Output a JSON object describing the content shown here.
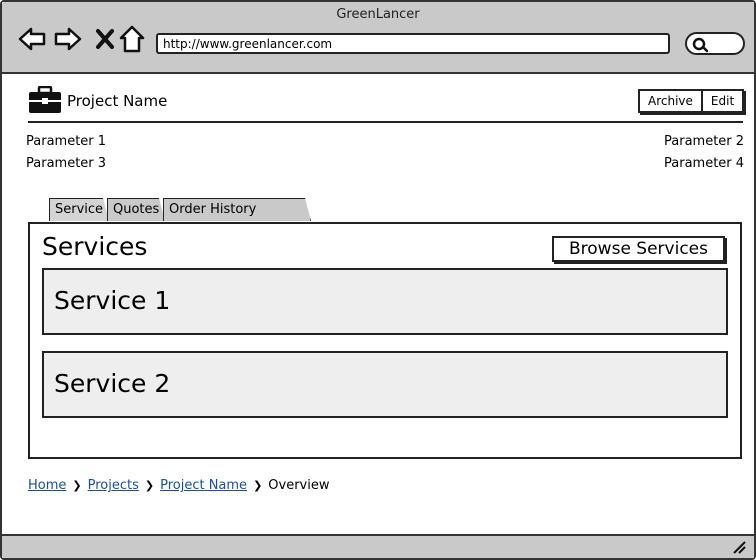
{
  "window": {
    "title": "GreenLancer"
  },
  "browser": {
    "url": "http://www.greenlancer.com",
    "back_icon": "arrow-left-icon",
    "forward_icon": "arrow-right-icon",
    "stop_icon": "close-icon",
    "home_icon": "home-icon",
    "search_icon": "search-icon"
  },
  "header": {
    "icon": "briefcase-icon",
    "project_name": "Project Name",
    "buttons": {
      "archive": "Archive",
      "edit": "Edit"
    }
  },
  "parameters": {
    "p1": "Parameter 1",
    "p2": "Parameter 2",
    "p3": "Parameter 3",
    "p4": "Parameter 4"
  },
  "tabs": [
    {
      "label": "Service",
      "active": true
    },
    {
      "label": "Quotes",
      "active": false
    },
    {
      "label": "Order History",
      "active": false
    }
  ],
  "panel": {
    "title": "Services",
    "browse_button": "Browse Services",
    "services": [
      {
        "label": "Service 1"
      },
      {
        "label": "Service 2"
      }
    ]
  },
  "breadcrumb": {
    "items": [
      "Home",
      "Projects",
      "Project Name"
    ],
    "current": "Overview"
  },
  "colors": {
    "chrome": "#c9c9c9",
    "link": "#1a4f9c",
    "card": "#eeeeee"
  }
}
